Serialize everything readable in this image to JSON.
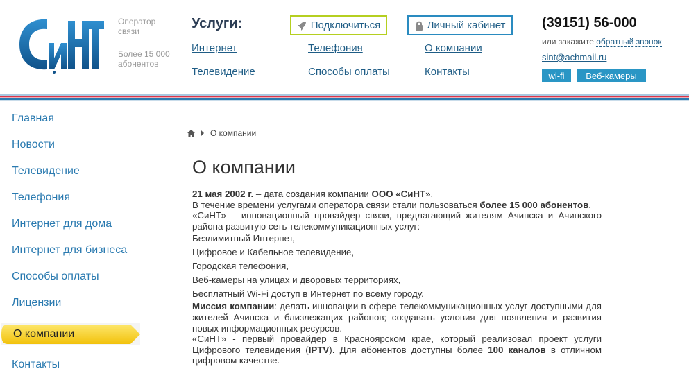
{
  "header": {
    "tagline_operator": "Оператор связи",
    "tagline_subscribers": "Более 15 000 абонентов",
    "services_title": "Услуги:",
    "links": {
      "internet": "Интернет",
      "telephony": "Телефония",
      "about": "О компании",
      "tv": "Телевидение",
      "payment": "Способы оплаты",
      "contacts": "Контакты"
    },
    "connect_label": "Подключиться",
    "cabinet_label": "Личный кабинет",
    "phone": "(39151) 56-000",
    "callback_prefix": "или закажите ",
    "callback_link": "обратный звонок",
    "email": "sint@achmail.ru",
    "tag_wifi": "wi-fi",
    "tag_cameras": "Веб-камеры"
  },
  "colors": {
    "brand_blue": "#2a7ab0",
    "logo_blue": "#1b6ea8",
    "accent_green": "#b5cf20",
    "tag_blue": "#2a96c5",
    "active_yellow": "#f7d11c",
    "stripe_red": "#d9364a",
    "stripe_blue": "#2a7ab0"
  },
  "sidebar": {
    "items": [
      "Главная",
      "Новости",
      "Телевидение",
      "Телефония",
      "Интернет для дома",
      "Интернет для бизнеса",
      "Способы оплаты",
      "Лицензии",
      "О компании",
      "Контакты"
    ],
    "active": "О компании"
  },
  "breadcrumb": {
    "home_icon": "home-icon",
    "current": "О компании"
  },
  "page": {
    "title": "О компании",
    "p1_bold": "21 мая 2002 г.",
    "p1_text1": " – дата создания  компании ",
    "p1_bold2": "ООО «СиНТ»",
    "p1_text2": ".",
    "p2_text": "В течение времени услугами оператора связи стали пользоваться ",
    "p2_bold": "более 15 000 абонентов",
    "p2_end": ".",
    "p3": "«СиНТ» – инновационный провайдер связи, предлагающий жителям Ачинска и Ачинского района развитую сеть телекоммуникационных услуг:",
    "list": [
      "Безлимитный Интернет,",
      "Цифровое и Кабельное телевидение,",
      "Городская телефония,",
      "Веб-камеры на улицах и дворовых территориях,",
      "Бесплатный Wi-Fi доступ в Интернет по всему городу."
    ],
    "mission_bold": "Миссия компании",
    "mission_text": ": делать инновации в сфере телекоммуникационных услуг доступными для жителей Ачинска и близлежащих районов; создавать условия для появления и развития новых информационных ресурсов.",
    "p5_text1": "«СиНТ» - первый провайдер в Красноярском крае, который реализовал проект услуги Цифрового телевидения (",
    "p5_bold1": "IPTV",
    "p5_text2": "). Для абонентов доступны более ",
    "p5_bold2": "100 каналов",
    "p5_text3": " в отличном цифровом качестве."
  }
}
